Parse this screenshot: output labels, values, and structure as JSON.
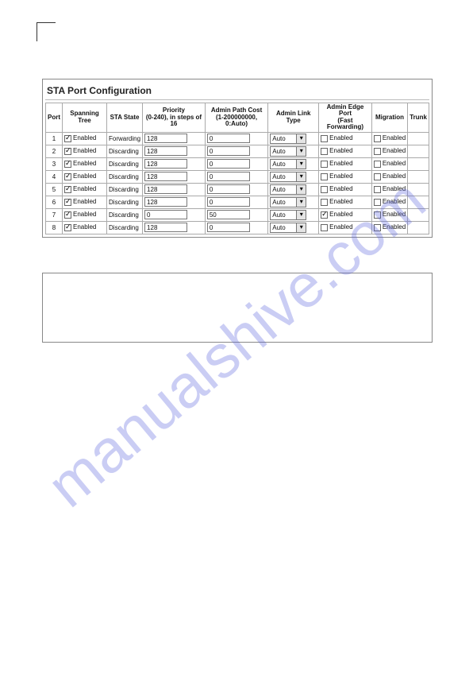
{
  "watermark": "manualshive.com",
  "panel": {
    "title": "STA Port Configuration",
    "headers": {
      "port": "Port",
      "spanning": "Spanning Tree",
      "state": "STA State",
      "priority": "Priority",
      "priority_sub": "(0-240), in steps of 16",
      "pathcost": "Admin Path Cost",
      "pathcost_sub": "(1-200000000, 0:Auto)",
      "linktype": "Admin Link Type",
      "edgeport": "Admin Edge Port",
      "edgeport_sub": "(Fast Forwarding)",
      "migration": "Migration",
      "trunk": "Trunk"
    },
    "enabled_label": "Enabled",
    "link_auto": "Auto",
    "rows": [
      {
        "port": "1",
        "spanning": true,
        "state": "Forwarding",
        "priority": "128",
        "pathcost": "0",
        "linktype": "Auto",
        "edge": false,
        "migration": false
      },
      {
        "port": "2",
        "spanning": true,
        "state": "Discarding",
        "priority": "128",
        "pathcost": "0",
        "linktype": "Auto",
        "edge": false,
        "migration": false
      },
      {
        "port": "3",
        "spanning": true,
        "state": "Discarding",
        "priority": "128",
        "pathcost": "0",
        "linktype": "Auto",
        "edge": false,
        "migration": false
      },
      {
        "port": "4",
        "spanning": true,
        "state": "Discarding",
        "priority": "128",
        "pathcost": "0",
        "linktype": "Auto",
        "edge": false,
        "migration": false
      },
      {
        "port": "5",
        "spanning": true,
        "state": "Discarding",
        "priority": "128",
        "pathcost": "0",
        "linktype": "Auto",
        "edge": false,
        "migration": false
      },
      {
        "port": "6",
        "spanning": true,
        "state": "Discarding",
        "priority": "128",
        "pathcost": "0",
        "linktype": "Auto",
        "edge": false,
        "migration": false
      },
      {
        "port": "7",
        "spanning": true,
        "state": "Discarding",
        "priority": "0",
        "pathcost": "50",
        "linktype": "Auto",
        "edge": true,
        "migration": false
      },
      {
        "port": "8",
        "spanning": true,
        "state": "Discarding",
        "priority": "128",
        "pathcost": "0",
        "linktype": "Auto",
        "edge": false,
        "migration": false
      }
    ]
  }
}
